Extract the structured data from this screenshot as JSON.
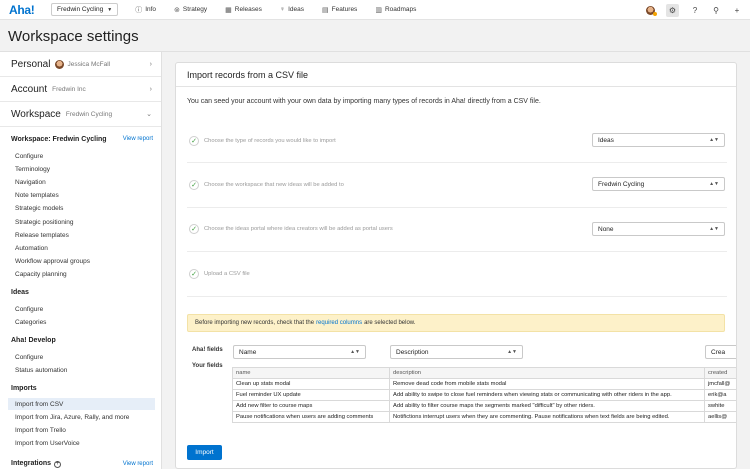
{
  "topbar": {
    "logo": "Aha!",
    "workspace_select": "Fredwin Cycling",
    "nav": [
      {
        "icon": "info-icon",
        "glyph": "ⓘ",
        "label": "Info"
      },
      {
        "icon": "strategy-icon",
        "glyph": "⊚",
        "label": "Strategy"
      },
      {
        "icon": "releases-icon",
        "glyph": "▦",
        "label": "Releases"
      },
      {
        "icon": "ideas-icon",
        "glyph": "♀",
        "label": "Ideas"
      },
      {
        "icon": "features-icon",
        "glyph": "▤",
        "label": "Features"
      },
      {
        "icon": "roadmaps-icon",
        "glyph": "▥",
        "label": "Roadmaps"
      }
    ]
  },
  "page": {
    "title": "Workspace settings"
  },
  "sidebar": {
    "accounts": [
      {
        "label": "Personal",
        "sub": "Jessica McFall",
        "chevron": "›"
      },
      {
        "label": "Account",
        "sub": "Fredwin Inc",
        "chevron": "›"
      },
      {
        "label": "Workspace",
        "sub": "Fredwin Cycling",
        "chevron": "⌄"
      }
    ],
    "sections": [
      {
        "title": "Workspace: Fredwin Cycling",
        "link": "View report",
        "items": [
          "Configure",
          "Terminology",
          "Navigation",
          "Note templates",
          "Strategic models",
          "Strategic positioning",
          "Release templates",
          "Automation",
          "Workflow approval groups",
          "Capacity planning"
        ]
      },
      {
        "title": "Ideas",
        "items": [
          "Configure",
          "Categories"
        ]
      },
      {
        "title": "Aha! Develop",
        "items": [
          "Configure",
          "Status automation"
        ]
      },
      {
        "title": "Imports",
        "items": [
          "Import from CSV",
          "Import from Jira, Azure, Rally, and more",
          "Import from Trello",
          "Import from UserVoice"
        ],
        "active_index": 0
      },
      {
        "title": "Integrations",
        "link": "View report"
      }
    ]
  },
  "main": {
    "card_title": "Import records from a CSV file",
    "intro": "You can seed your account with your own data by importing many types of records in Aha! directly from a CSV file.",
    "steps": [
      {
        "label": "Choose the type of records you would like to import",
        "value": "Ideas"
      },
      {
        "label": "Choose the workspace that new ideas will be added to",
        "value": "Fredwin Cycling"
      },
      {
        "label": "Choose the ideas portal where idea creators will be added as portal users",
        "value": "None"
      },
      {
        "label": "Upload a CSV file",
        "value": null
      }
    ],
    "notice": {
      "before": "Before importing new records, check that the",
      "link": "required columns",
      "after": "are selected below."
    },
    "aha_fields_label": "Aha! fields",
    "your_fields_label": "Your fields",
    "field_selects": [
      "Name",
      "Description",
      "Crea"
    ],
    "table": {
      "headers": [
        "name",
        "description",
        "created"
      ],
      "rows": [
        [
          "Clean up stats modal",
          "Remove dead code from mobile stats modal",
          "jmcfall@"
        ],
        [
          "Fuel reminder UX update",
          "Add ability to swipe to close fuel reminders when viewing stats or communicating with other riders in the app.",
          "erik@a"
        ],
        [
          "Add new filter to course maps",
          "Add ability to filter course maps the segments marked \"difficult\" by other riders.",
          "swhite"
        ],
        [
          "Pause notifications when users are adding comments",
          "Notifictions interrupt users when they are commenting. Pause notifications when text fields are being edited.",
          "aellis@"
        ]
      ]
    },
    "import_button": "Import"
  }
}
